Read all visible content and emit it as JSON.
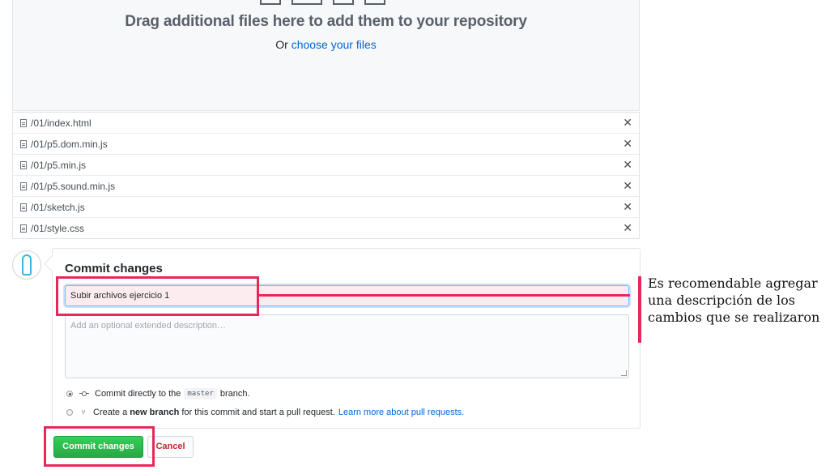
{
  "dropzone": {
    "title": "Drag additional files here to add them to your repository",
    "sub_prefix": "Or",
    "sub_link": "choose your files"
  },
  "files": [
    "/01/index.html",
    "/01/p5.dom.min.js",
    "/01/p5.min.js",
    "/01/p5.sound.min.js",
    "/01/sketch.js",
    "/01/style.css"
  ],
  "file_remove_glyph": "✕",
  "commit": {
    "title": "Commit changes",
    "summary_value": "Subir archivos ejercicio 1",
    "description_placeholder": "Add an optional extended description…",
    "option_direct": {
      "prefix": "Commit directly to the",
      "branch": "master",
      "suffix": "branch."
    },
    "option_new_branch": {
      "prefix": "Create a",
      "bold": "new branch",
      "suffix": "for this commit and start a pull request.",
      "link": "Learn more about pull requests."
    },
    "submit_label": "Commit changes",
    "cancel_label": "Cancel"
  },
  "annotation": {
    "text": "Es recomendable agregar una descripción de los cambios que se realizaron",
    "highlight_color": "#e8285a"
  },
  "icons": [
    "file-icon",
    "close-icon",
    "avatar",
    "git-commit-icon",
    "pull-request-icon"
  ]
}
